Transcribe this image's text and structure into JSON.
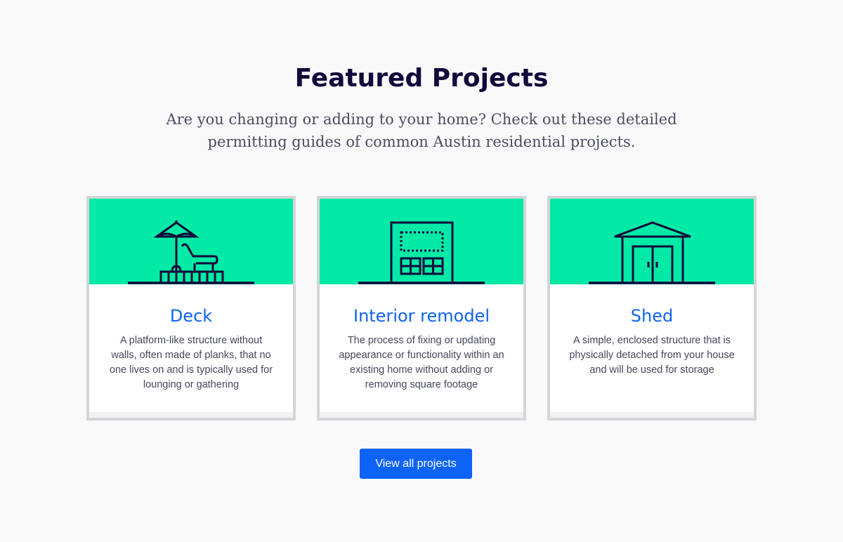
{
  "section": {
    "title": "Featured Projects",
    "intro": "Are you changing or adding to your home? Check out these detailed permitting guides of common Austin residential projects."
  },
  "cards": [
    {
      "icon": "deck-umbrella-lounge-chair-icon",
      "title": "Deck",
      "description": "A platform-like structure without walls, often made of planks, that no one lives on and is typically used for lounging or gathering"
    },
    {
      "icon": "interior-room-window-icon",
      "title": "Interior remodel",
      "description": "The process of fixing or updating appearance or functionality within an existing home without adding or removing square footage"
    },
    {
      "icon": "shed-double-door-icon",
      "title": "Shed",
      "description": "A simple, enclosed structure that is physically detached from your house and will be used for storage"
    }
  ],
  "cta": {
    "label": "View all projects"
  },
  "colors": {
    "heading": "#12083a",
    "accent_green": "#03eaa6",
    "link_blue": "#0d63f0",
    "button_blue": "#0d63f5",
    "card_border": "#d4d5d9",
    "page_bg": "#f9f9fa"
  }
}
